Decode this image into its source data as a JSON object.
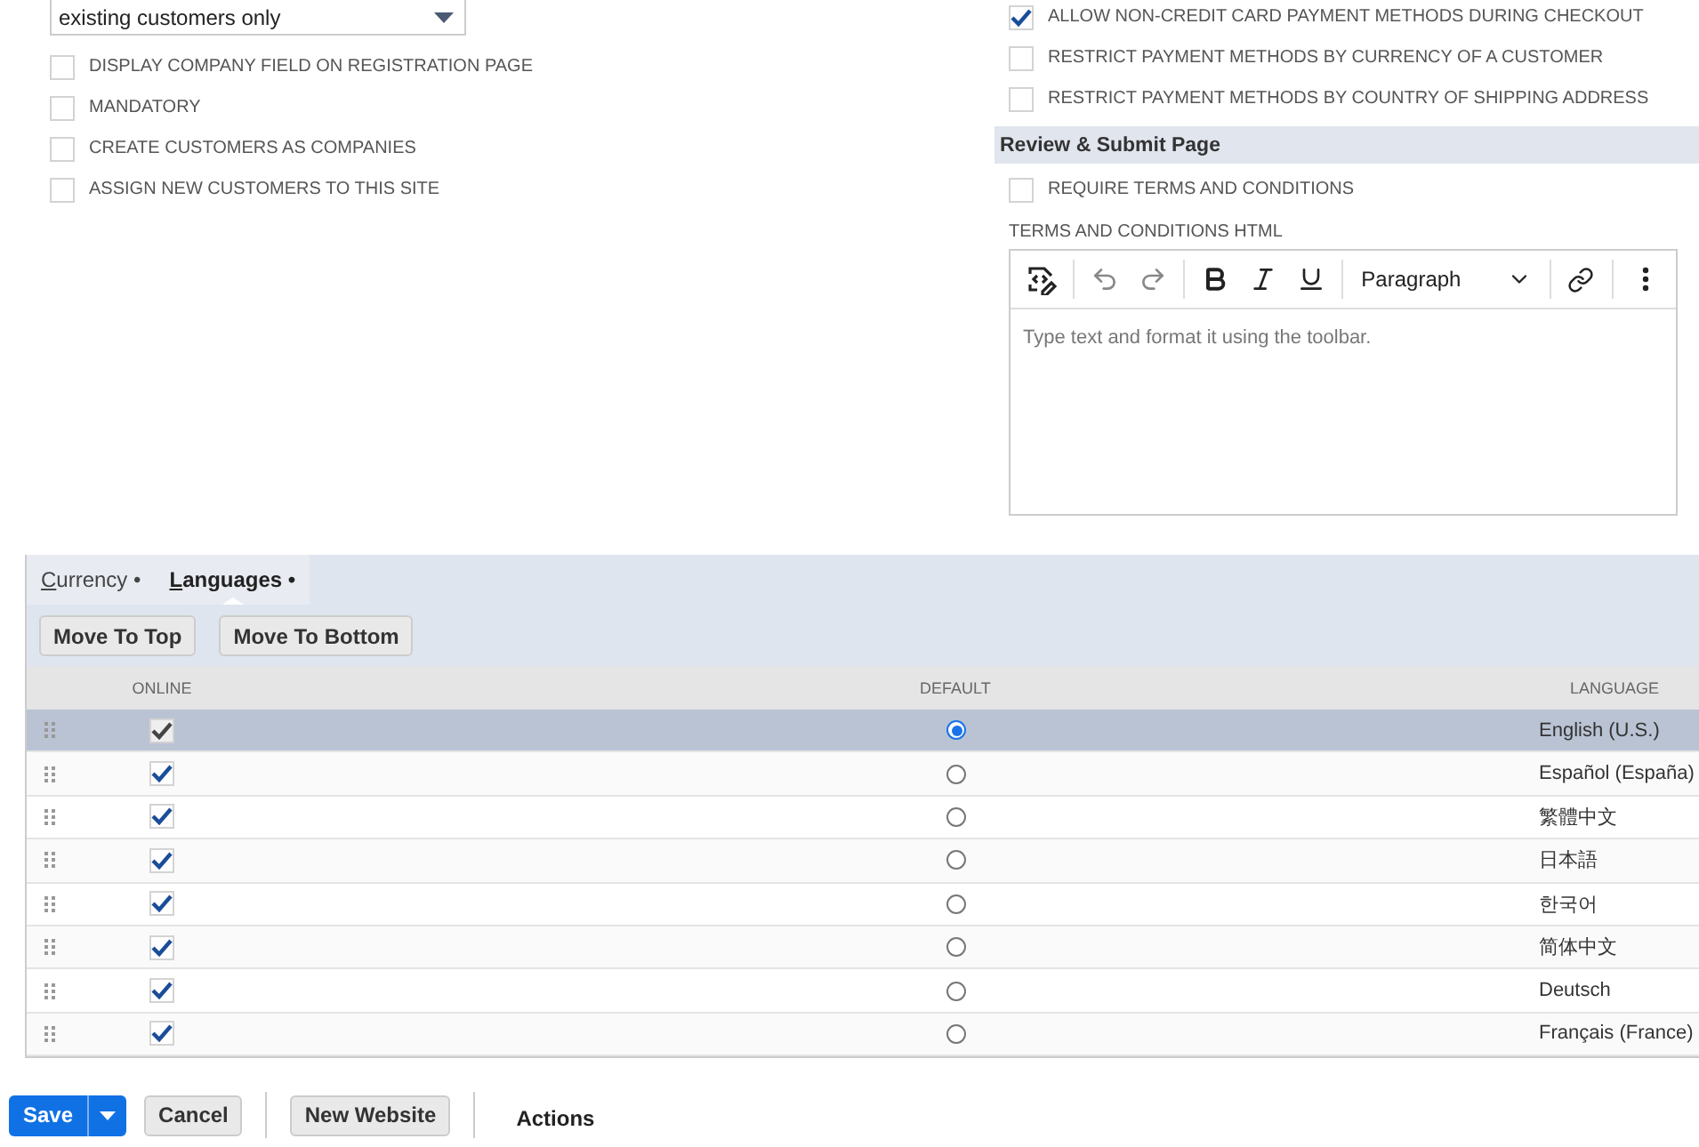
{
  "left_panel": {
    "dropdown": {
      "value": "existing customers only"
    },
    "checkboxes": [
      {
        "label": "DISPLAY COMPANY FIELD ON REGISTRATION PAGE",
        "checked": false
      },
      {
        "label": "MANDATORY",
        "checked": false
      },
      {
        "label": "CREATE CUSTOMERS AS COMPANIES",
        "checked": false
      },
      {
        "label": "ASSIGN NEW CUSTOMERS TO THIS SITE",
        "checked": false
      }
    ]
  },
  "right_panel": {
    "checkboxes": [
      {
        "label": "ALLOW NON-CREDIT CARD PAYMENT METHODS DURING CHECKOUT",
        "checked": true
      },
      {
        "label": "RESTRICT PAYMENT METHODS BY CURRENCY OF A CUSTOMER",
        "checked": false
      },
      {
        "label": "RESTRICT PAYMENT METHODS BY COUNTRY OF SHIPPING ADDRESS",
        "checked": false
      }
    ],
    "section": {
      "title": "Review & Submit Page",
      "checkboxes": [
        {
          "label": "REQUIRE TERMS AND CONDITIONS",
          "checked": false
        }
      ],
      "editor": {
        "label": "TERMS AND CONDITIONS HTML",
        "format": "Paragraph",
        "placeholder": "Type text and format it using the toolbar."
      }
    }
  },
  "subtabs": [
    {
      "label": "Currency •",
      "selected": false
    },
    {
      "label": "Languages •",
      "selected": true
    }
  ],
  "list_buttons": [
    "Move To Top",
    "Move To Bottom"
  ],
  "table": {
    "columns": [
      "ONLINE",
      "DEFAULT",
      "LANGUAGE"
    ],
    "rows": [
      {
        "online": true,
        "default": true,
        "language": "English (U.S.)",
        "selected": true
      },
      {
        "online": true,
        "default": false,
        "language": "Español (España)",
        "selected": false
      },
      {
        "online": true,
        "default": false,
        "language": "繁體中文",
        "selected": false
      },
      {
        "online": true,
        "default": false,
        "language": "日本語",
        "selected": false
      },
      {
        "online": true,
        "default": false,
        "language": "한국어",
        "selected": false
      },
      {
        "online": true,
        "default": false,
        "language": "简体中文",
        "selected": false
      },
      {
        "online": true,
        "default": false,
        "language": "Deutsch",
        "selected": false
      },
      {
        "online": true,
        "default": false,
        "language": "Français (France)",
        "selected": false
      }
    ]
  },
  "footer": {
    "save": "Save",
    "buttons": [
      "Cancel",
      "New Website"
    ],
    "actions": "Actions"
  }
}
